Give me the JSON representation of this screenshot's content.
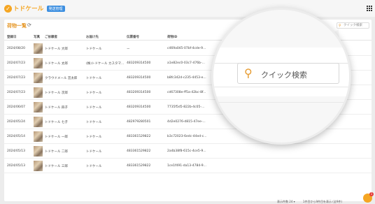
{
  "header": {
    "logo_text": "トドケール",
    "badge": "発送管理"
  },
  "main": {
    "title": "荷物一覧",
    "search_placeholder": "クイック検索"
  },
  "table": {
    "columns": [
      "登録日",
      "写真",
      "ご依頼者",
      "お届け先",
      "伝票番号",
      "荷物ID"
    ],
    "rows": [
      {
        "date": "2024/08/20",
        "sender": "トドケール 大郎",
        "dest": "トドケール",
        "track": "ー",
        "uid": "c469a045-07bf-4cde-9..."
      },
      {
        "date": "2024/07/23",
        "sender": "トドケール 太郎",
        "dest": "(株)トドケール カスタマ...",
        "track": "483209314500",
        "uid": "a1e82ec0-03c7-476b-..."
      },
      {
        "date": "2024/07/23",
        "sender": "クラウドメール 宮太郎",
        "dest": "トドケール",
        "track": "483209314500",
        "uid": "b8fc342d-c235-4453-e..."
      },
      {
        "date": "2024/07/23",
        "sender": "トドケール 次郎",
        "dest": "トドケール",
        "track": "483209314500",
        "uid": "cd67308e-ff5a-42bc-8f..."
      },
      {
        "date": "2024/06/07",
        "sender": "トドケール 四子",
        "dest": "トドケール",
        "track": "483209314500",
        "uid": "7735f5d5-822b-4c05-..."
      },
      {
        "date": "2024/05/24",
        "sender": "トドケール 七子",
        "dest": "トドケール",
        "track": "482979280501",
        "uid": "4d2e0276-d815-47ee-..."
      },
      {
        "date": "2024/05/14",
        "sender": "トドケール 一郎",
        "dest": "トドケール",
        "track": "483361529822",
        "uid": "b3c72023-6edc-44ed-c..."
      },
      {
        "date": "2024/05/13",
        "sender": "トドケール 二郎",
        "dest": "トドケール",
        "track": "483361529822",
        "uid": "2a4b38f8-615c-4ce5-9..."
      },
      {
        "date": "2024/05/13",
        "sender": "トドケール 三郎",
        "dest": "トドケール",
        "track": "483361529822",
        "uid": "1ce1f491-da13-4784-9..."
      }
    ]
  },
  "footer": {
    "per_page": "表示件数 24 ▾",
    "range": "1件目から9件目を表示 (全9件)"
  },
  "chat": {
    "badge": "1"
  },
  "colors": {
    "accent": "#e69a2e",
    "brand": "#f5a623",
    "badge_blue": "#3d8fe0"
  }
}
